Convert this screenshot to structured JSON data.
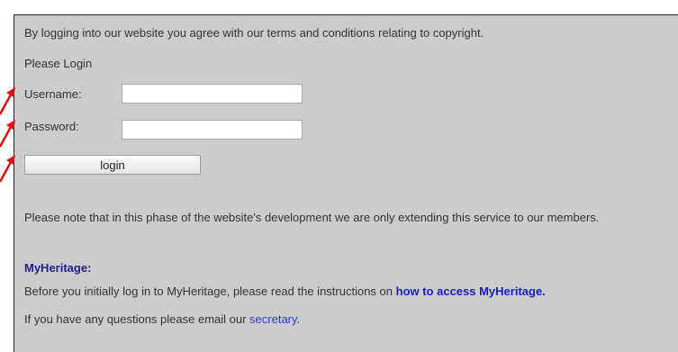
{
  "colors": {
    "panel_background": "#cccccc",
    "text": "#333333",
    "heading": "#1f1f8c",
    "link": "#1a1acc",
    "annotation_arrow": "#e01010"
  },
  "notice": {
    "terms_text": "By logging into our website you agree with our terms and conditions relating to copyright."
  },
  "login": {
    "prompt": "Please Login",
    "username_label": "Username:",
    "username_value": "",
    "password_label": "Password:",
    "password_value": "",
    "login_button": "login"
  },
  "info": {
    "members_note": "Please note that in this phase of the website's development we are only extending this service to our members.",
    "myheritage_heading": "MyHeritage:",
    "instructions_text": "Before you initially log in to MyHeritage, please read the instructions on ",
    "instructions_link": "how to access MyHeritage.",
    "contact_text": "If you have any questions please email our ",
    "contact_link": "secretary",
    "contact_end": "."
  },
  "annotations": {
    "arrow_icon": "red-arrow-icon"
  }
}
